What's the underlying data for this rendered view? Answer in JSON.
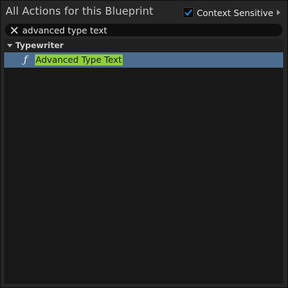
{
  "header": {
    "title": "All Actions for this Blueprint",
    "context_sensitive_label": "Context Sensitive",
    "context_sensitive_checked": true
  },
  "search": {
    "value": "advanced type text"
  },
  "list": {
    "category": "Typewriter",
    "items": [
      {
        "label": "Advanced Type Text",
        "icon": "function-icon",
        "selected": true
      }
    ]
  },
  "colors": {
    "selection": "#4b6c8e",
    "highlight": "#8ed03c",
    "checkbox_check": "#2f86d8"
  }
}
